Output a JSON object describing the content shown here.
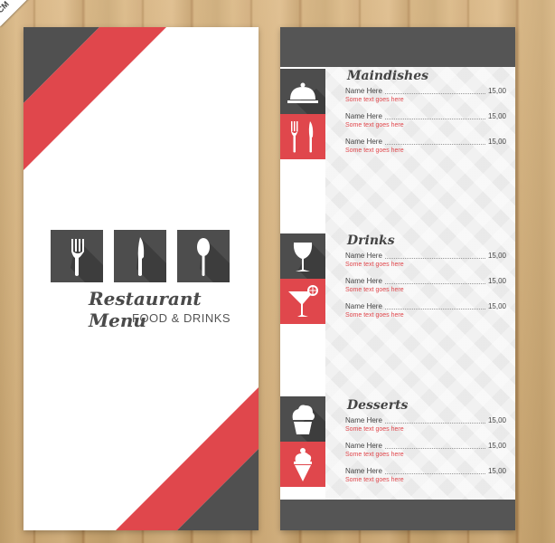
{
  "corner_tag": "CM",
  "colors": {
    "accent_red": "#e0474c",
    "dark_gray": "#4d4d4d",
    "panel_white": "#ffffff"
  },
  "cover": {
    "icons": [
      "fork-icon",
      "knife-icon",
      "spoon-icon"
    ],
    "title": "Restaurant Menu",
    "subtitle": "FOOD & DRINKS"
  },
  "menu": {
    "sections": [
      {
        "title": "Maindishes",
        "icons": [
          "cloche-icon",
          "fork-knife-icon"
        ],
        "items": [
          {
            "name": "Name Here",
            "price": "15,00",
            "desc": "Some text goes here"
          },
          {
            "name": "Name Here",
            "price": "15,00",
            "desc": "Some text goes here"
          },
          {
            "name": "Name Here",
            "price": "15,00",
            "desc": "Some text goes here"
          }
        ]
      },
      {
        "title": "Drinks",
        "icons": [
          "wine-glass-icon",
          "cocktail-icon"
        ],
        "items": [
          {
            "name": "Name Here",
            "price": "15,00",
            "desc": "Some text goes here"
          },
          {
            "name": "Name Here",
            "price": "15,00",
            "desc": "Some text goes here"
          },
          {
            "name": "Name Here",
            "price": "15,00",
            "desc": "Some text goes here"
          }
        ]
      },
      {
        "title": "Desserts",
        "icons": [
          "cupcake-icon",
          "ice-cream-icon"
        ],
        "items": [
          {
            "name": "Name Here",
            "price": "15,00",
            "desc": "Some text goes here"
          },
          {
            "name": "Name Here",
            "price": "15,00",
            "desc": "Some text goes here"
          },
          {
            "name": "Name Here",
            "price": "15,00",
            "desc": "Some text goes here"
          }
        ]
      }
    ]
  }
}
